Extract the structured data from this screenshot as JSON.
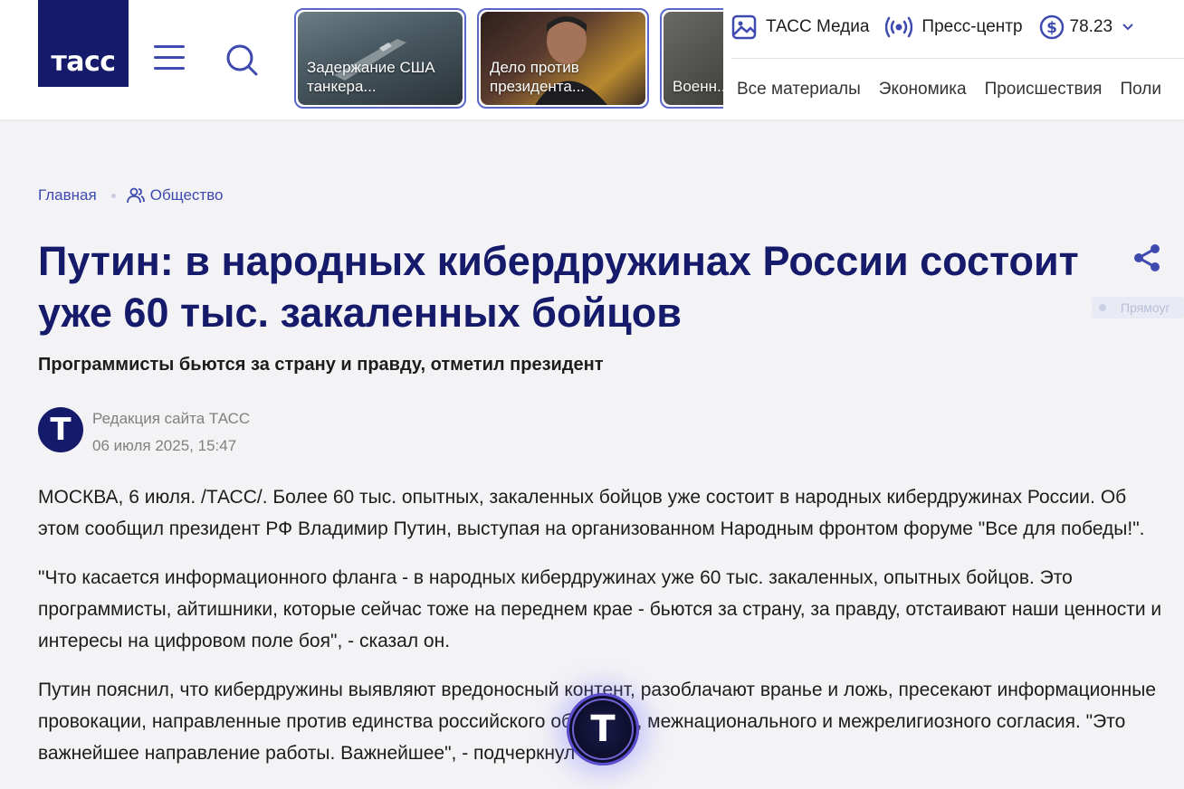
{
  "header": {
    "logo_text": "тасс",
    "stories": [
      {
        "caption": "Задержание США танкера..."
      },
      {
        "caption": "Дело против президента..."
      },
      {
        "caption": "Военн... на Ук..."
      }
    ],
    "topnav": {
      "media": "ТАСС Медиа",
      "press": "Пресс-центр",
      "currency": "78.23"
    },
    "subnav": [
      "Все материалы",
      "Экономика",
      "Происшествия",
      "Поли"
    ]
  },
  "breadcrumb": {
    "home": "Главная",
    "section": "Общество"
  },
  "article": {
    "title": "Путин: в народных кибердружинах России состоит уже 60 тыс. закаленных бойцов",
    "subtitle": "Программисты бьются за страну и правду, отметил президент",
    "author": "Редакция сайта ТАСС",
    "date": "06 июля 2025, 15:47",
    "live_label": "Прямоуг",
    "paragraphs": [
      "МОСКВА, 6 июля. /ТАСС/. Более 60 тыс. опытных, закаленных бойцов уже состоит в народных кибердружинах России. Об этом сообщил президент РФ Владимир Путин, выступая на организованном Народным фронтом форуме \"Все для победы!\".",
      "\"Что касается информационного фланга - в народных кибердружинах уже 60 тыс. закаленных, опытных бойцов. Это программисты, айтишники, которые сейчас тоже на переднем крае - бьются за страну, за правду, отстаивают наши ценности и интересы на цифровом поле боя\", - сказал он.",
      "Путин пояснил, что кибердружины выявляют вредоносный контент, разоблачают вранье и ложь, пресекают информационные провокации, направленные против единства российского общества, межнационального и межрелигиозного согласия. \"Это важнейшее направление работы. Важнейшее\", - подчеркнул он."
    ]
  },
  "avatar_letter": "Т",
  "fab_letter": "Т",
  "colors": {
    "brand_navy": "#151a6a",
    "accent": "#3e4ab0",
    "background": "#f3f3f5"
  }
}
